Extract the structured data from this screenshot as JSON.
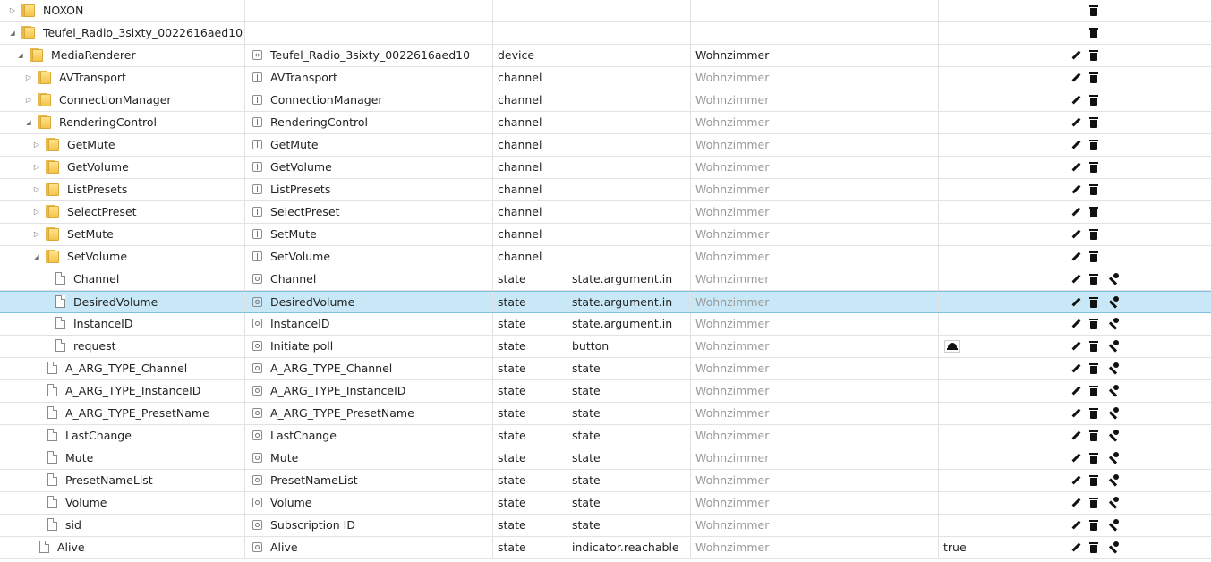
{
  "rows": [
    {
      "id": "NOXON",
      "name": "",
      "type": "",
      "role": "",
      "room": "",
      "value": "",
      "level": 0,
      "node": "folder",
      "toggle": "collapsed",
      "name_icon": "",
      "actions": [
        "delete"
      ]
    },
    {
      "id": "Teufel_Radio_3sixty_0022616aed10",
      "name": "",
      "type": "",
      "role": "",
      "room": "",
      "value": "",
      "level": 0,
      "node": "folder",
      "toggle": "expanded",
      "name_icon": "",
      "actions": [
        "delete"
      ]
    },
    {
      "id": "MediaRenderer",
      "name": "Teufel_Radio_3sixty_0022616aed10",
      "type": "device",
      "role": "",
      "room": "Wohnzimmer",
      "room_strong": true,
      "value": "",
      "level": 1,
      "node": "folder",
      "toggle": "expanded",
      "name_icon": "device",
      "actions": [
        "edit",
        "delete"
      ]
    },
    {
      "id": "AVTransport",
      "name": "AVTransport",
      "type": "channel",
      "role": "",
      "room": "Wohnzimmer",
      "value": "",
      "level": 2,
      "node": "folder",
      "toggle": "collapsed",
      "name_icon": "channel",
      "actions": [
        "edit",
        "delete"
      ]
    },
    {
      "id": "ConnectionManager",
      "name": "ConnectionManager",
      "type": "channel",
      "role": "",
      "room": "Wohnzimmer",
      "value": "",
      "level": 2,
      "node": "folder",
      "toggle": "collapsed",
      "name_icon": "channel",
      "actions": [
        "edit",
        "delete"
      ]
    },
    {
      "id": "RenderingControl",
      "name": "RenderingControl",
      "type": "channel",
      "role": "",
      "room": "Wohnzimmer",
      "value": "",
      "level": 2,
      "node": "folder",
      "toggle": "expanded",
      "name_icon": "channel",
      "actions": [
        "edit",
        "delete"
      ]
    },
    {
      "id": "GetMute",
      "name": "GetMute",
      "type": "channel",
      "role": "",
      "room": "Wohnzimmer",
      "value": "",
      "level": 3,
      "node": "folder",
      "toggle": "collapsed",
      "name_icon": "channel",
      "actions": [
        "edit",
        "delete"
      ]
    },
    {
      "id": "GetVolume",
      "name": "GetVolume",
      "type": "channel",
      "role": "",
      "room": "Wohnzimmer",
      "value": "",
      "level": 3,
      "node": "folder",
      "toggle": "collapsed",
      "name_icon": "channel",
      "actions": [
        "edit",
        "delete"
      ]
    },
    {
      "id": "ListPresets",
      "name": "ListPresets",
      "type": "channel",
      "role": "",
      "room": "Wohnzimmer",
      "value": "",
      "level": 3,
      "node": "folder",
      "toggle": "collapsed",
      "name_icon": "channel",
      "actions": [
        "edit",
        "delete"
      ]
    },
    {
      "id": "SelectPreset",
      "name": "SelectPreset",
      "type": "channel",
      "role": "",
      "room": "Wohnzimmer",
      "value": "",
      "level": 3,
      "node": "folder",
      "toggle": "collapsed",
      "name_icon": "channel",
      "actions": [
        "edit",
        "delete"
      ]
    },
    {
      "id": "SetMute",
      "name": "SetMute",
      "type": "channel",
      "role": "",
      "room": "Wohnzimmer",
      "value": "",
      "level": 3,
      "node": "folder",
      "toggle": "collapsed",
      "name_icon": "channel",
      "actions": [
        "edit",
        "delete"
      ]
    },
    {
      "id": "SetVolume",
      "name": "SetVolume",
      "type": "channel",
      "role": "",
      "room": "Wohnzimmer",
      "value": "",
      "level": 3,
      "node": "folder",
      "toggle": "expanded",
      "name_icon": "channel",
      "actions": [
        "edit",
        "delete"
      ]
    },
    {
      "id": "Channel",
      "name": "Channel",
      "type": "state",
      "role": "state.argument.in",
      "room": "Wohnzimmer",
      "value": "",
      "level": 4,
      "node": "file",
      "toggle": "",
      "name_icon": "state",
      "actions": [
        "edit",
        "delete",
        "config"
      ]
    },
    {
      "id": "DesiredVolume",
      "name": "DesiredVolume",
      "type": "state",
      "role": "state.argument.in",
      "room": "Wohnzimmer",
      "value": "",
      "level": 4,
      "node": "file",
      "toggle": "",
      "name_icon": "state",
      "actions": [
        "edit",
        "delete",
        "config"
      ],
      "selected": true
    },
    {
      "id": "InstanceID",
      "name": "InstanceID",
      "type": "state",
      "role": "state.argument.in",
      "room": "Wohnzimmer",
      "value": "",
      "level": 4,
      "node": "file",
      "toggle": "",
      "name_icon": "state",
      "actions": [
        "edit",
        "delete",
        "config"
      ]
    },
    {
      "id": "request",
      "name": "Initiate poll",
      "type": "state",
      "role": "button",
      "room": "Wohnzimmer",
      "value": "",
      "level": 4,
      "node": "file",
      "toggle": "",
      "name_icon": "state",
      "actions": [
        "edit",
        "delete",
        "config"
      ],
      "bell": true
    },
    {
      "id": "A_ARG_TYPE_Channel",
      "name": "A_ARG_TYPE_Channel",
      "type": "state",
      "role": "state",
      "room": "Wohnzimmer",
      "value": "",
      "level": 3,
      "node": "file",
      "toggle": "",
      "name_icon": "state",
      "actions": [
        "edit",
        "delete",
        "config"
      ]
    },
    {
      "id": "A_ARG_TYPE_InstanceID",
      "name": "A_ARG_TYPE_InstanceID",
      "type": "state",
      "role": "state",
      "room": "Wohnzimmer",
      "value": "",
      "level": 3,
      "node": "file",
      "toggle": "",
      "name_icon": "state",
      "actions": [
        "edit",
        "delete",
        "config"
      ]
    },
    {
      "id": "A_ARG_TYPE_PresetName",
      "name": "A_ARG_TYPE_PresetName",
      "type": "state",
      "role": "state",
      "room": "Wohnzimmer",
      "value": "",
      "level": 3,
      "node": "file",
      "toggle": "",
      "name_icon": "state",
      "actions": [
        "edit",
        "delete",
        "config"
      ]
    },
    {
      "id": "LastChange",
      "name": "LastChange",
      "type": "state",
      "role": "state",
      "room": "Wohnzimmer",
      "value": "",
      "level": 3,
      "node": "file",
      "toggle": "",
      "name_icon": "state",
      "actions": [
        "edit",
        "delete",
        "config"
      ]
    },
    {
      "id": "Mute",
      "name": "Mute",
      "type": "state",
      "role": "state",
      "room": "Wohnzimmer",
      "value": "",
      "level": 3,
      "node": "file",
      "toggle": "",
      "name_icon": "state",
      "actions": [
        "edit",
        "delete",
        "config"
      ]
    },
    {
      "id": "PresetNameList",
      "name": "PresetNameList",
      "type": "state",
      "role": "state",
      "room": "Wohnzimmer",
      "value": "",
      "level": 3,
      "node": "file",
      "toggle": "",
      "name_icon": "state",
      "actions": [
        "edit",
        "delete",
        "config"
      ]
    },
    {
      "id": "Volume",
      "name": "Volume",
      "type": "state",
      "role": "state",
      "room": "Wohnzimmer",
      "value": "",
      "level": 3,
      "node": "file",
      "toggle": "",
      "name_icon": "state",
      "actions": [
        "edit",
        "delete",
        "config"
      ]
    },
    {
      "id": "sid",
      "name": "Subscription ID",
      "type": "state",
      "role": "state",
      "room": "Wohnzimmer",
      "value": "",
      "level": 3,
      "node": "file",
      "toggle": "",
      "name_icon": "state",
      "actions": [
        "edit",
        "delete",
        "config"
      ]
    },
    {
      "id": "Alive",
      "name": "Alive",
      "type": "state",
      "role": "indicator.reachable",
      "room": "Wohnzimmer",
      "value": "true",
      "level": 2,
      "node": "file",
      "toggle": "",
      "name_icon": "state",
      "actions": [
        "edit",
        "delete",
        "config"
      ]
    }
  ],
  "colors": {
    "selected_row": "#c9e8f7",
    "folder": "#f2c449",
    "muted_text": "#9a9a9a"
  }
}
